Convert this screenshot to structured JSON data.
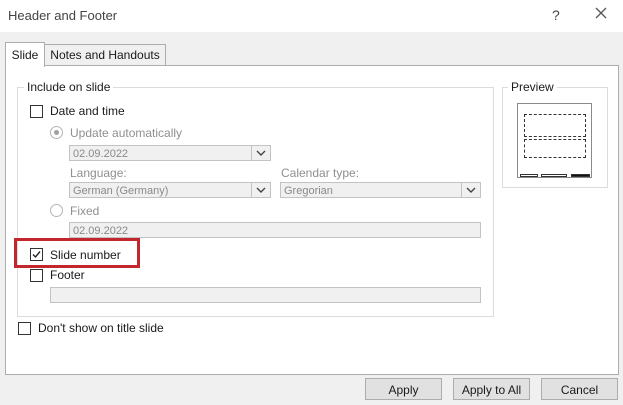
{
  "window": {
    "title": "Header and Footer"
  },
  "tabs": [
    {
      "label": "Slide",
      "selected": true
    },
    {
      "label": "Notes and Handouts",
      "selected": false
    }
  ],
  "include": {
    "legend": "Include on slide",
    "date_time": {
      "label": "Date and time",
      "checked": false,
      "update_auto": {
        "label": "Update automatically",
        "selected": true
      },
      "date_value": "02.09.2022",
      "language_label": "Language:",
      "language_value": "German (Germany)",
      "calendar_label": "Calendar type:",
      "calendar_value": "Gregorian",
      "fixed": {
        "label": "Fixed",
        "selected": false
      },
      "fixed_value": "02.09.2022"
    },
    "slide_number": {
      "label": "Slide number",
      "checked": true
    },
    "footer": {
      "label": "Footer",
      "checked": false,
      "value": ""
    }
  },
  "dont_show": {
    "label": "Don't show on title slide",
    "checked": false
  },
  "preview": {
    "legend": "Preview"
  },
  "buttons": {
    "apply": "Apply",
    "apply_all": "Apply to All",
    "cancel": "Cancel"
  },
  "colors": {
    "highlight": "#c1272d"
  }
}
